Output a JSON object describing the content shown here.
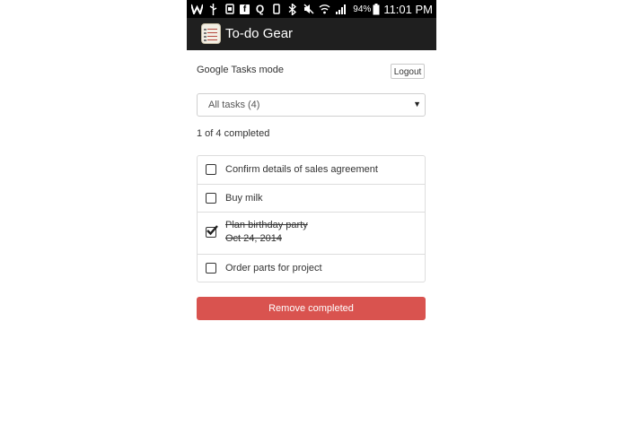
{
  "status_bar": {
    "left_icons": [
      "whatsapp-icon",
      "usb-icon",
      "sim-icon",
      "facebook-icon",
      "quora-icon",
      "device-icon",
      "bluetooth-icon",
      "mute-icon",
      "wifi-icon",
      "signal-icon"
    ],
    "battery_percent": "94%",
    "time": "11:01 PM"
  },
  "app_bar": {
    "title": "To-do Gear",
    "logo_icon": "todo-notepad-icon"
  },
  "mode": {
    "label": "Google Tasks mode",
    "logout_label": "Logout"
  },
  "filter": {
    "selected": "All tasks (4)",
    "caret_icon": "caret-down-icon"
  },
  "progress": {
    "text": "1 of 4 completed"
  },
  "tasks": [
    {
      "title": "Confirm details of sales agreement",
      "completed": false,
      "date": ""
    },
    {
      "title": "Buy milk",
      "completed": false,
      "date": ""
    },
    {
      "title": "Plan birthday party",
      "completed": true,
      "date": "Oct 24, 2014"
    },
    {
      "title": "Order parts for project",
      "completed": false,
      "date": ""
    }
  ],
  "actions": {
    "remove_completed_label": "Remove completed"
  },
  "colors": {
    "status_bar": "#000000",
    "app_bar": "#1f1f1f",
    "danger": "#d9534f",
    "border": "#dddddd"
  }
}
